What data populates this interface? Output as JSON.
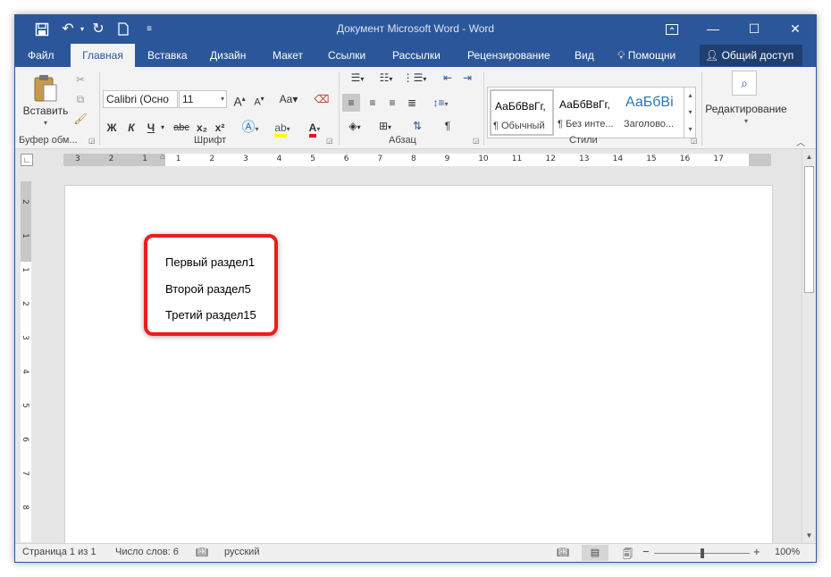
{
  "titlebar": {
    "title": "Документ Microsoft Word - Word"
  },
  "tabs": [
    {
      "label": "Файл"
    },
    {
      "label": "Главная"
    },
    {
      "label": "Вставка"
    },
    {
      "label": "Дизайн"
    },
    {
      "label": "Макет"
    },
    {
      "label": "Ссылки"
    },
    {
      "label": "Рассылки"
    },
    {
      "label": "Рецензирование"
    },
    {
      "label": "Вид"
    }
  ],
  "help": {
    "label": "Помощни"
  },
  "share": {
    "label": "Общий доступ"
  },
  "ribbon": {
    "clipboard": {
      "paste_label": "Вставить",
      "group_label": "Буфер обм..."
    },
    "font": {
      "font_name": "Calibri (Осно",
      "font_size": "11",
      "bold": "Ж",
      "italic": "К",
      "underline": "Ч",
      "strike": "abc",
      "subscript": "x₂",
      "superscript": "x²",
      "group_label": "Шрифт"
    },
    "paragraph": {
      "group_label": "Абзац"
    },
    "styles": {
      "items": [
        {
          "sample": "АаБбВвГг,",
          "name": "¶ Обычный"
        },
        {
          "sample": "АаБбВвГг,",
          "name": "¶ Без инте..."
        },
        {
          "sample": "АаБбВі",
          "name": "Заголово..."
        }
      ],
      "group_label": "Стили"
    },
    "editing": {
      "label": "Редактирование"
    }
  },
  "ruler": {
    "numbers": [
      "3",
      "2",
      "1",
      "1",
      "2",
      "3",
      "4",
      "5",
      "6",
      "7",
      "8",
      "9",
      "10",
      "11",
      "12",
      "13",
      "14",
      "15",
      "16",
      "17"
    ]
  },
  "vruler": {
    "numbers": [
      "2",
      "1",
      "1",
      "2",
      "3",
      "4",
      "5",
      "6",
      "7",
      "8"
    ]
  },
  "document": {
    "lines": [
      "Первый раздел1",
      "Второй раздел5",
      "Третий раздел15"
    ]
  },
  "statusbar": {
    "page": "Страница 1 из 1",
    "words": "Число слов: 6",
    "language": "русский",
    "zoom": "100%",
    "zoom_level": 1.0
  },
  "colors": {
    "accent": "#2b579a",
    "highlight_border": "#ee1c1c",
    "font_color_underline": "#e81123",
    "highlight_marker": "#ffff00"
  }
}
